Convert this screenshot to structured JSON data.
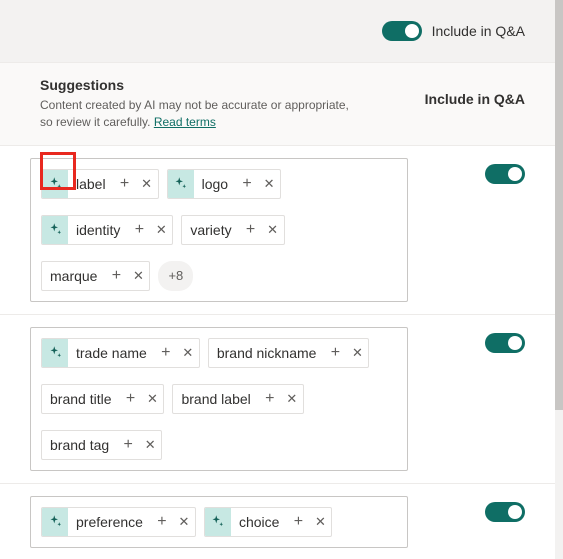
{
  "topBar": {
    "toggleLabel": "Include in Q&A",
    "toggleOn": true
  },
  "header": {
    "title": "Suggestions",
    "desc_a": "Content created by AI may not be accurate or appropriate, so review it carefully. ",
    "readTerms": "Read terms",
    "colLabel": "Include in Q&A"
  },
  "groups": [
    {
      "toggleOn": true,
      "moreLabel": "+8",
      "tags": [
        {
          "ai": true,
          "label": "label"
        },
        {
          "ai": true,
          "label": "logo"
        },
        {
          "ai": true,
          "label": "identity"
        },
        {
          "ai": false,
          "label": "variety"
        },
        {
          "ai": false,
          "label": "marque"
        }
      ]
    },
    {
      "toggleOn": true,
      "moreLabel": null,
      "tags": [
        {
          "ai": true,
          "label": "trade name"
        },
        {
          "ai": false,
          "label": "brand nickname"
        },
        {
          "ai": false,
          "label": "brand title"
        },
        {
          "ai": false,
          "label": "brand label"
        },
        {
          "ai": false,
          "label": "brand tag"
        }
      ]
    },
    {
      "toggleOn": true,
      "moreLabel": null,
      "tags": [
        {
          "ai": true,
          "label": "preference"
        },
        {
          "ai": true,
          "label": "choice"
        }
      ]
    }
  ]
}
